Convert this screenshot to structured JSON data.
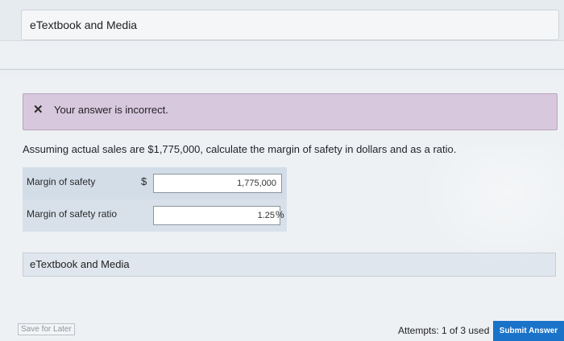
{
  "top_etextbook": {
    "label": "eTextbook and Media"
  },
  "feedback": {
    "icon": "close-icon",
    "message": "Your answer is incorrect.",
    "colors": {
      "background": "#d8c8de",
      "border": "#b6a4bf"
    }
  },
  "question": {
    "text": "Assuming actual sales are $1,775,000, calculate the margin of safety in dollars and as a ratio."
  },
  "answers": {
    "margin_of_safety": {
      "label": "Margin of safety",
      "prefix": "$",
      "value": "1,775,000"
    },
    "margin_of_safety_ratio": {
      "label": "Margin of safety ratio",
      "value": "1.25",
      "suffix": "%"
    }
  },
  "bottom_etextbook": {
    "label": "eTextbook and Media"
  },
  "footer": {
    "save_later": "Save for Later",
    "attempts": "Attempts: 1 of 3 used",
    "submit": "Submit Answer",
    "submit_color": "#1a73c9"
  }
}
